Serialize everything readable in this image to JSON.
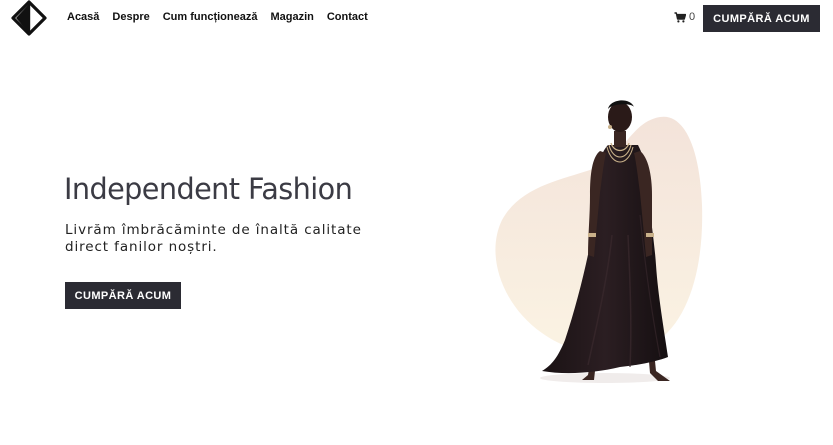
{
  "header": {
    "logo_icon": "diamond-logo-icon",
    "nav": [
      {
        "label": "Acasă"
      },
      {
        "label": "Despre"
      },
      {
        "label": "Cum funcționează"
      },
      {
        "label": "Magazin"
      },
      {
        "label": "Contact"
      }
    ],
    "cart": {
      "icon": "cart-icon",
      "count": "0"
    },
    "cta_label": "CUMPĂRĂ ACUM"
  },
  "hero": {
    "title": "Independent Fashion",
    "subtitle": "Livrăm îmbrăcăminte de înaltă calitate direct fanilor noștri.",
    "cta_label": "CUMPĂRĂ ACUM",
    "image": "model-in-black-dress-image"
  },
  "colors": {
    "button_bg": "#2b2b33",
    "title_text": "#3b3b44",
    "blob_top": "#f3e3da",
    "blob_bottom": "#fbf3e3"
  }
}
